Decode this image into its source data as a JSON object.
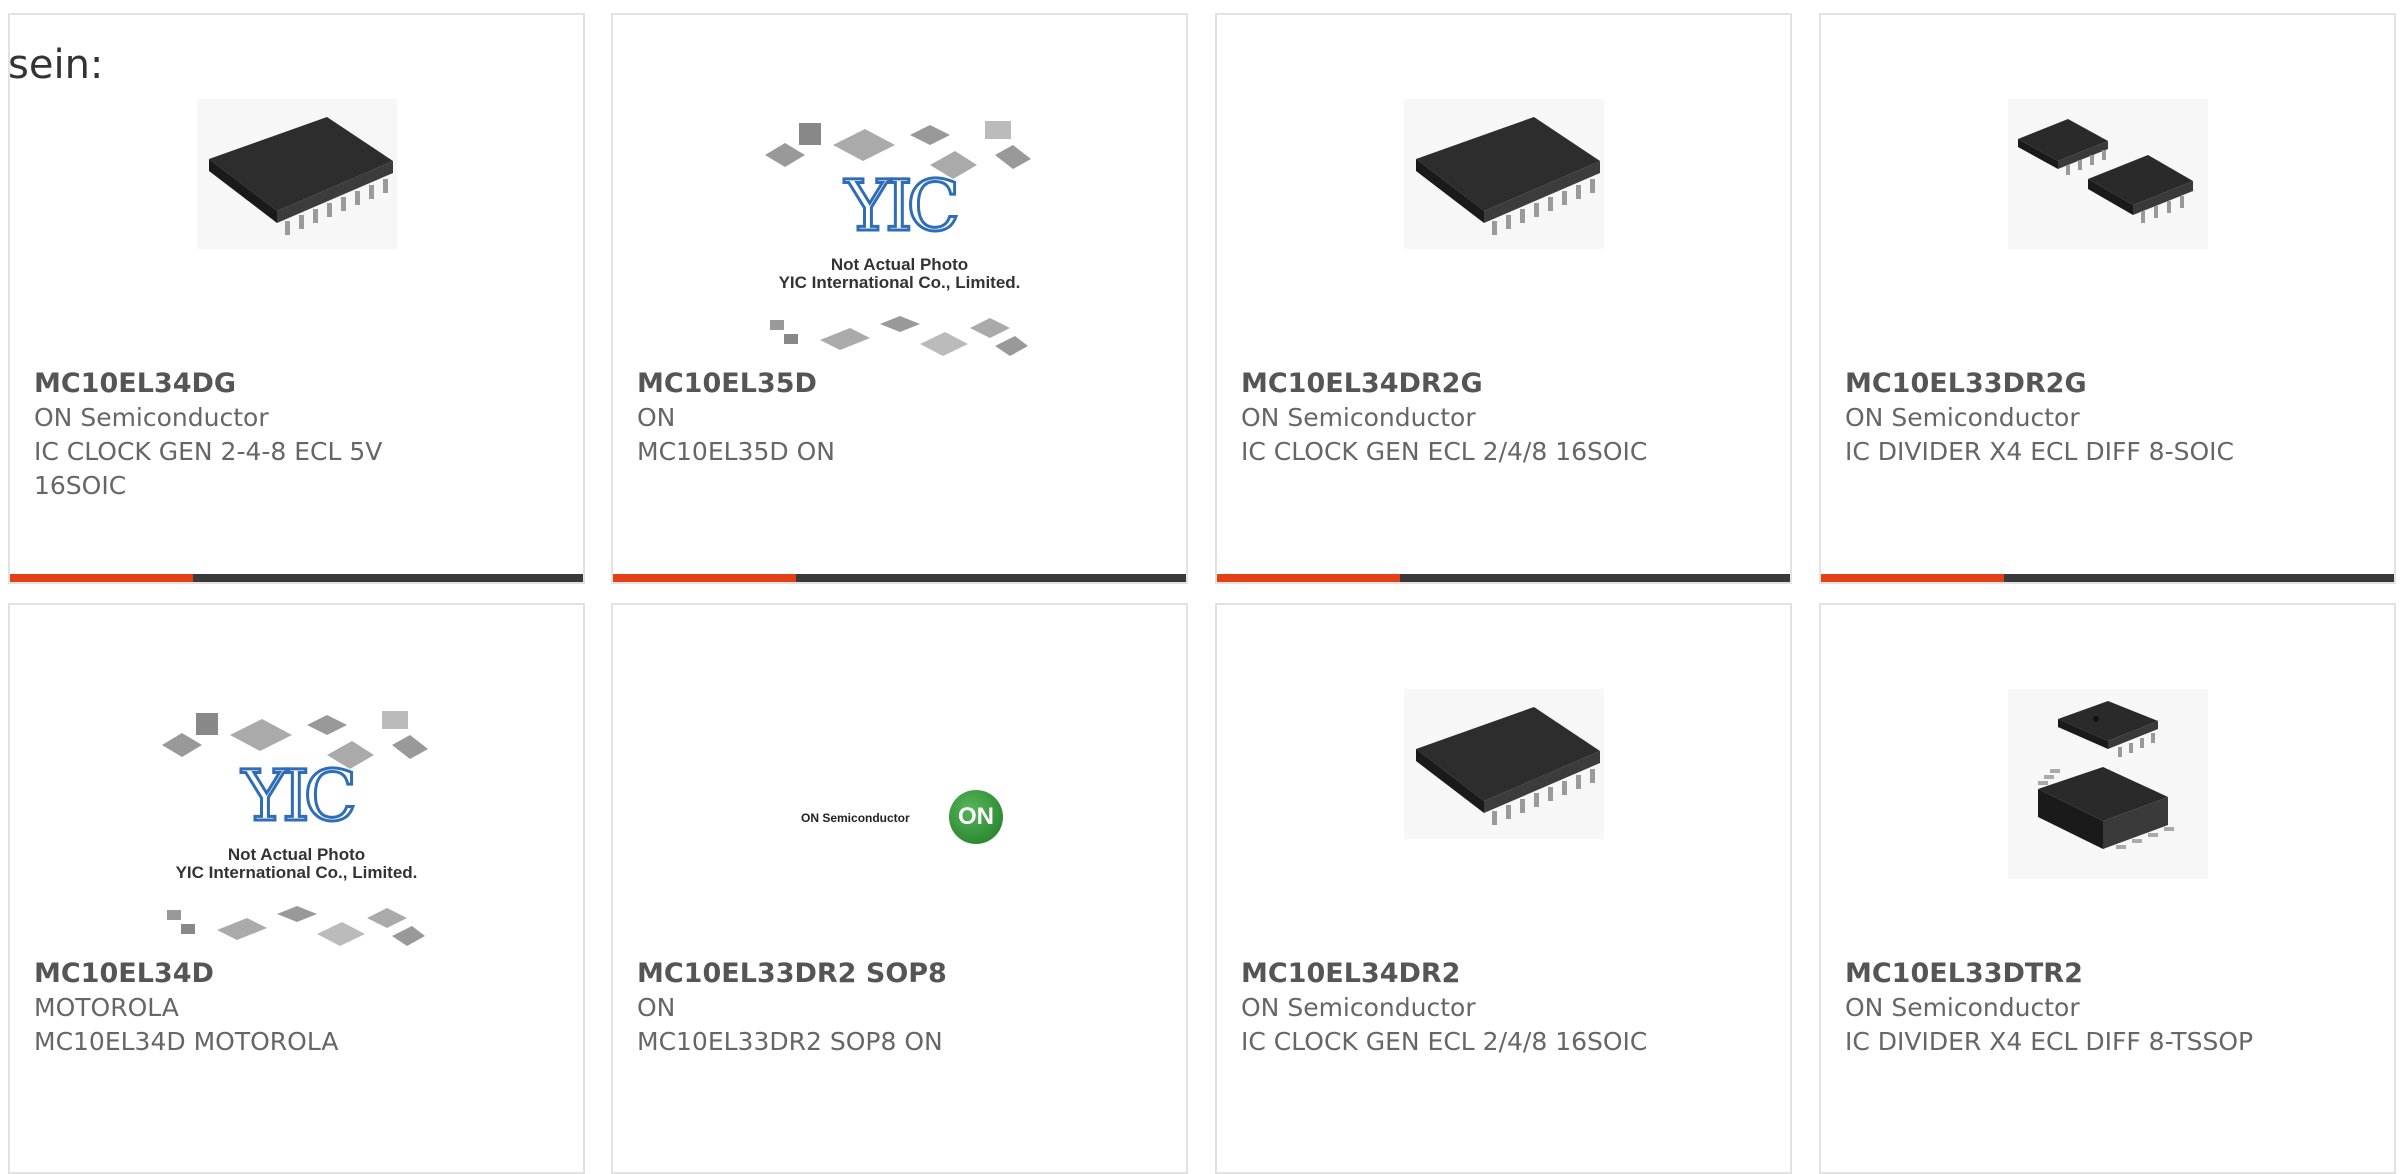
{
  "intro_text": "sein:",
  "products": [
    {
      "part": "MC10EL34DG",
      "brand": "ON Semiconductor",
      "desc": "IC CLOCK GEN 2-4-8 ECL 5V 16SOIC",
      "image": "soic16-chip"
    },
    {
      "part": "MC10EL35D",
      "brand": "ON",
      "desc": "MC10EL35D ON",
      "image": "yic-placeholder"
    },
    {
      "part": "MC10EL34DR2G",
      "brand": "ON Semiconductor",
      "desc": "IC CLOCK GEN ECL 2/4/8 16SOIC",
      "image": "soic16-chip"
    },
    {
      "part": "MC10EL33DR2G",
      "brand": "ON Semiconductor",
      "desc": "IC DIVIDER X4 ECL DIFF 8-SOIC",
      "image": "soic8-pair"
    },
    {
      "part": "MC10EL34D",
      "brand": "MOTOROLA",
      "desc": "MC10EL34D MOTOROLA",
      "image": "yic-placeholder"
    },
    {
      "part": "MC10EL33DR2 SOP8",
      "brand": "ON",
      "desc": "MC10EL33DR2 SOP8 ON",
      "image": "on-logo"
    },
    {
      "part": "MC10EL34DR2",
      "brand": "ON Semiconductor",
      "desc": "IC CLOCK GEN ECL 2/4/8 16SOIC",
      "image": "soic16-chip"
    },
    {
      "part": "MC10EL33DTR2",
      "brand": "ON Semiconductor",
      "desc": "IC DIVIDER X4 ECL DIFF 8-TSSOP",
      "image": "tssop8-pair"
    }
  ],
  "yic_placeholder": {
    "logo": "YIC",
    "line1": "Not Actual Photo",
    "line2": "YIC International Co., Limited."
  },
  "on_logo": {
    "wordmark": "ON Semiconductor",
    "badge": "ON"
  },
  "colors": {
    "accent": "#e34016",
    "bar": "#3a3a3a",
    "border": "#e2e2e2"
  }
}
